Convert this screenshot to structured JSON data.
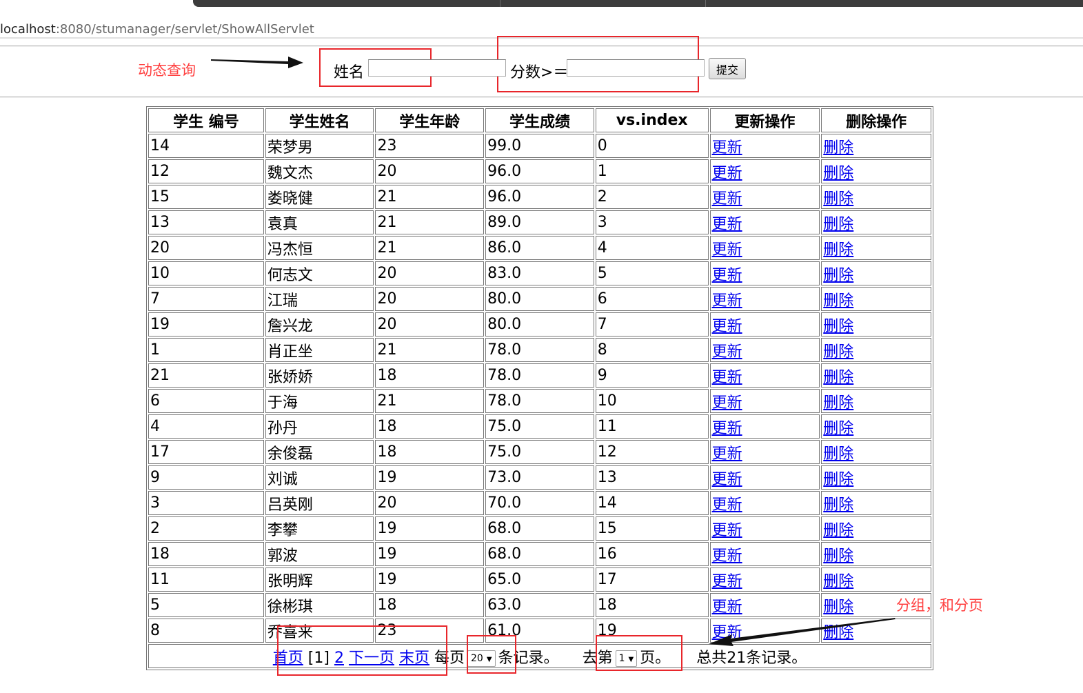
{
  "browser": {
    "url_host": "localhost",
    "url_path": ":8080/stumanager/servlet/ShowAllServlet"
  },
  "annotations": {
    "dynamic_query": "动态查询",
    "grouping_paging": "分组，和分页"
  },
  "search_form": {
    "name_label": "姓名",
    "name_value": "",
    "score_label": "分数>＝",
    "score_value": "",
    "submit_label": "提交"
  },
  "table": {
    "headers": [
      "学生 编号",
      "学生姓名",
      "学生年龄",
      "学生成绩",
      "vs.index",
      "更新操作",
      "删除操作"
    ],
    "update_link": "更新",
    "delete_link": "删除",
    "rows": [
      [
        "14",
        "荣梦男",
        "23",
        "99.0",
        "0"
      ],
      [
        "12",
        "魏文杰",
        "20",
        "96.0",
        "1"
      ],
      [
        "15",
        "娄晓健",
        "21",
        "96.0",
        "2"
      ],
      [
        "13",
        "袁真",
        "21",
        "89.0",
        "3"
      ],
      [
        "20",
        "冯杰恒",
        "21",
        "86.0",
        "4"
      ],
      [
        "10",
        "何志文",
        "20",
        "83.0",
        "5"
      ],
      [
        "7",
        "江瑞",
        "20",
        "80.0",
        "6"
      ],
      [
        "19",
        "詹兴龙",
        "20",
        "80.0",
        "7"
      ],
      [
        "1",
        "肖正坐",
        "21",
        "78.0",
        "8"
      ],
      [
        "21",
        "张娇娇",
        "18",
        "78.0",
        "9"
      ],
      [
        "6",
        "于海",
        "21",
        "78.0",
        "10"
      ],
      [
        "4",
        "孙丹",
        "18",
        "75.0",
        "11"
      ],
      [
        "17",
        "余俊磊",
        "18",
        "75.0",
        "12"
      ],
      [
        "9",
        "刘诚",
        "19",
        "73.0",
        "13"
      ],
      [
        "3",
        "吕英刚",
        "20",
        "70.0",
        "14"
      ],
      [
        "2",
        "李攀",
        "19",
        "68.0",
        "15"
      ],
      [
        "18",
        "郭波",
        "19",
        "68.0",
        "16"
      ],
      [
        "11",
        "张明辉",
        "19",
        "65.0",
        "17"
      ],
      [
        "5",
        "徐彬琪",
        "18",
        "63.0",
        "18"
      ],
      [
        "8",
        "乔喜来",
        "23",
        "61.0",
        "19"
      ]
    ]
  },
  "pagination": {
    "first_label": "首页",
    "current_page": "[1]",
    "page2_label": "2",
    "next_label": "下一页",
    "last_label": "末页",
    "per_page_prefix": "每页",
    "per_page_value": "20",
    "per_page_suffix": "条记录。",
    "goto_prefix": "去第",
    "goto_value": "1",
    "goto_suffix": "页。",
    "total_text": "总共21条记录。"
  },
  "colors": {
    "annotation_red": "#ff4040",
    "link_blue": "#0000ee"
  }
}
